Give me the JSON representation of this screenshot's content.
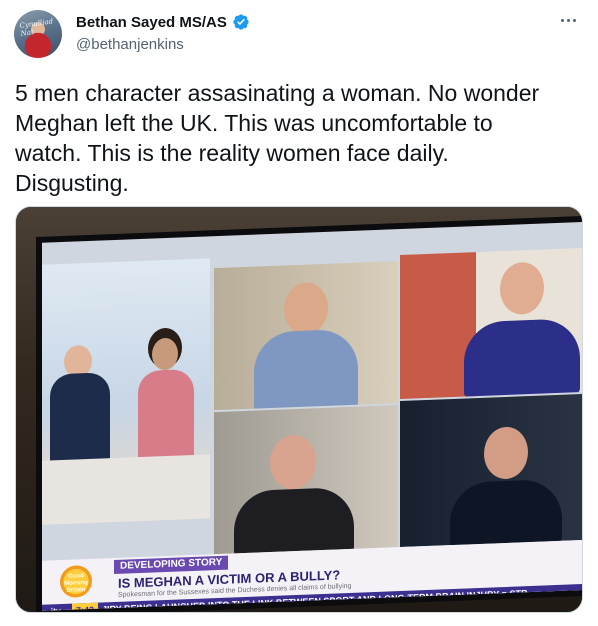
{
  "author": {
    "display_name": "Bethan Sayed MS/AS",
    "handle": "@bethanjenkins",
    "avatar_text": "Cynulliad Nat"
  },
  "tweet": {
    "text": "5 men character assasinating a woman. No wonder\nMeghan left the UK. This was uncomfortable to\nwatch. This is the reality women face daily.\nDisgusting."
  },
  "media": {
    "type": "photo",
    "logo_text": "Good Morning Britain",
    "developing_label": "DEVELOPING STORY",
    "headline": "IS MEGHAN A VICTIM OR A BULLY?",
    "subline": "Spokesman for the Sussexes said the Duchess denies all claims of bullying",
    "channel": "itv",
    "time": "7:42",
    "ticker": "JIRY BEING LAUNCHED INTO THE LINK BETWEEN SPORT AND LONG-TERM BRAIN INJURY  ■  STR"
  },
  "colors": {
    "verified": "#1d9bf0",
    "text_primary": "#0f1419",
    "text_secondary": "#536471"
  },
  "icons": {
    "verified": "verified-badge-icon",
    "more": "more-options-icon"
  }
}
